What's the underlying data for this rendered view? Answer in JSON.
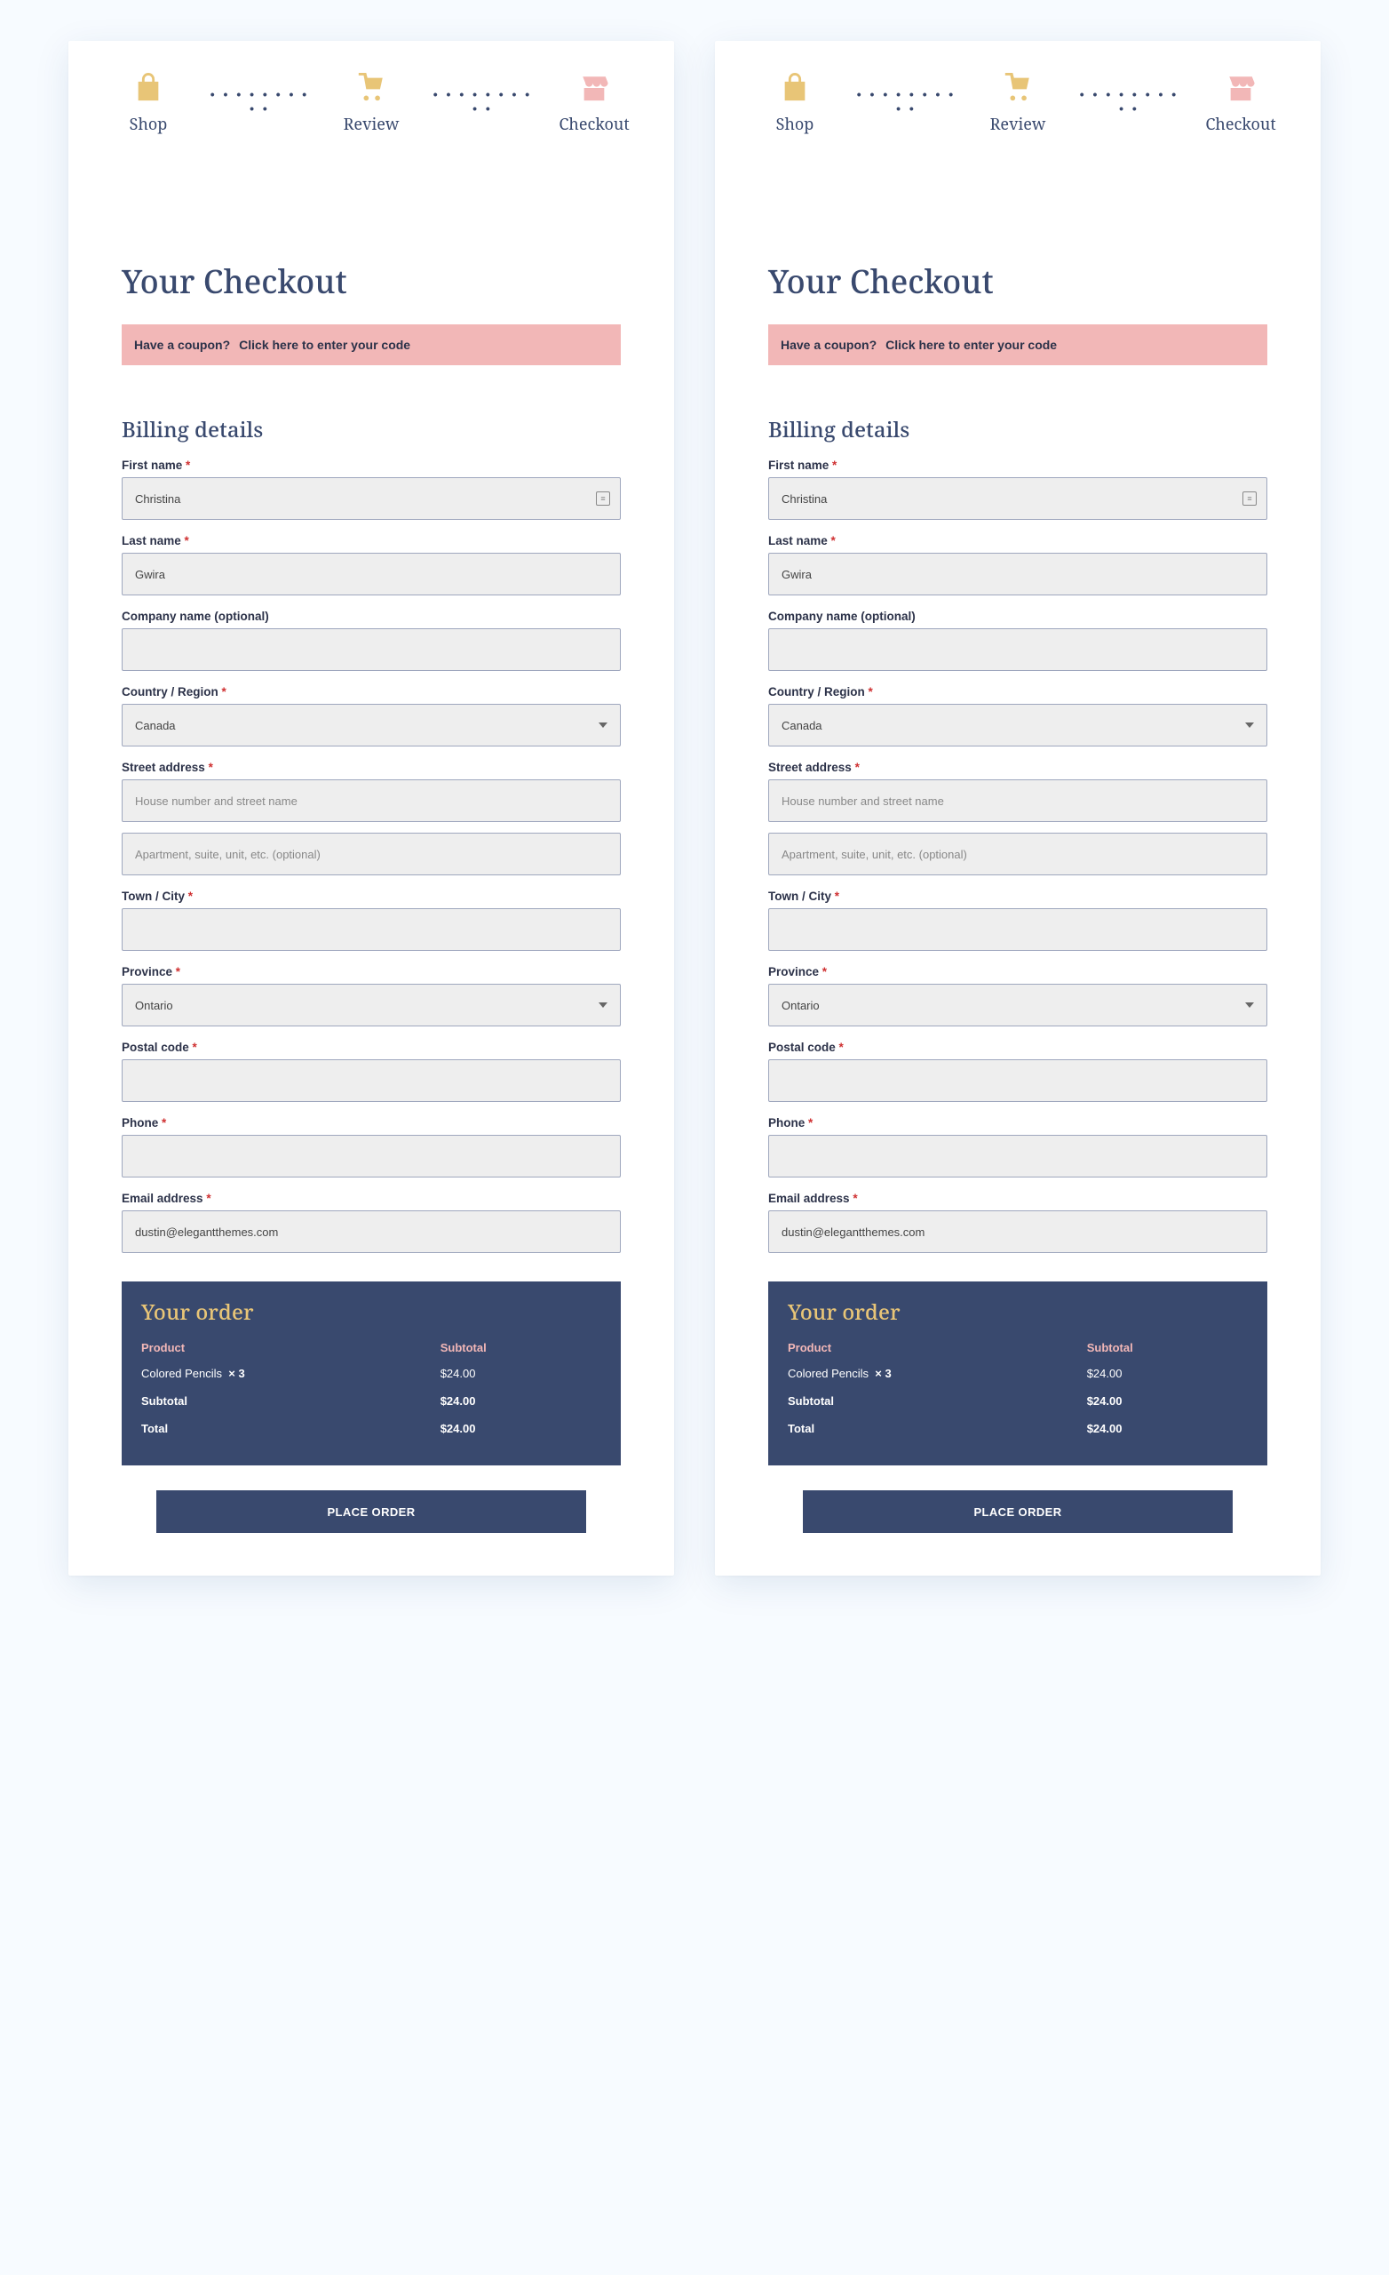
{
  "progress": {
    "shop": {
      "label": "Shop",
      "color": "#E8C577"
    },
    "review": {
      "label": "Review",
      "color": "#E8C577"
    },
    "checkout": {
      "label": "Checkout",
      "color": "#F2B7B7"
    }
  },
  "page_title": "Your Checkout",
  "coupon": {
    "prompt": "Have a coupon?",
    "link": "Click here to enter your code"
  },
  "billing_heading": "Billing details",
  "labels": {
    "first_name": "First name",
    "last_name": "Last name",
    "company": "Company name (optional)",
    "country": "Country / Region",
    "street": "Street address",
    "town": "Town / City",
    "province": "Province",
    "postal": "Postal code",
    "phone": "Phone",
    "email": "Email address"
  },
  "placeholders": {
    "street1": "House number and street name",
    "street2": "Apartment, suite, unit, etc. (optional)"
  },
  "values": {
    "first_name": "Christina",
    "last_name": "Gwira",
    "company": "",
    "country": "Canada",
    "street1": "",
    "street2": "",
    "town": "",
    "province": "Ontario",
    "postal": "",
    "phone": "",
    "email": "dustin@elegantthemes.com"
  },
  "required_mark": "*",
  "order": {
    "heading": "Your order",
    "cols": {
      "product": "Product",
      "subtotal": "Subtotal"
    },
    "items": [
      {
        "name": "Colored Pencils",
        "qty": "× 3",
        "amount": "$24.00"
      }
    ],
    "subtotal_label": "Subtotal",
    "subtotal_value": "$24.00",
    "total_label": "Total",
    "total_value": "$24.00"
  },
  "button_label": "PLACE ORDER"
}
